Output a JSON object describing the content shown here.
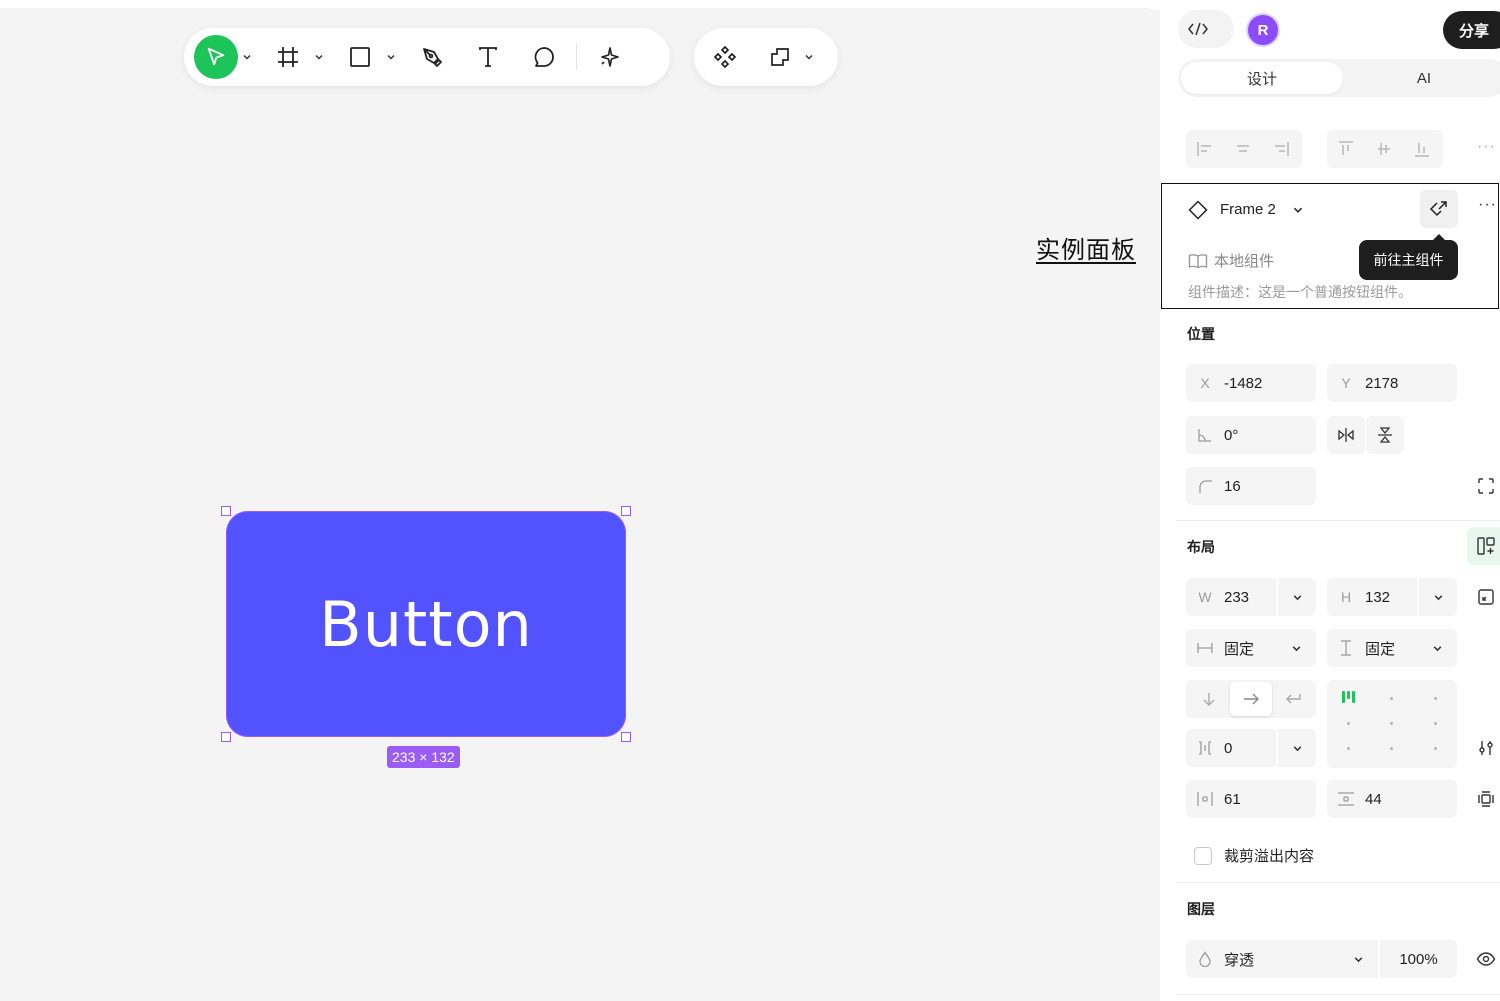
{
  "canvas": {
    "label": "实例面板",
    "frame_text": "Button",
    "size_badge": "233 × 132"
  },
  "toolbar": {
    "tools": [
      "move-tool",
      "frame-tool",
      "rectangle-tool",
      "pen-tool",
      "text-tool",
      "comment-tool",
      "ai-tool"
    ],
    "secondary": [
      "component-tool",
      "boolean-tool"
    ]
  },
  "header": {
    "avatar_initial": "R",
    "share_label": "分享"
  },
  "tabs": [
    {
      "label": "设计",
      "active": true
    },
    {
      "label": "AI",
      "active": false
    }
  ],
  "component": {
    "name": "Frame 2",
    "goto_tooltip": "前往主组件",
    "source": "本地组件",
    "description": "组件描述：这是一个普通按钮组件。"
  },
  "position": {
    "title": "位置",
    "x_label": "X",
    "x": "-1482",
    "y_label": "Y",
    "y": "2178",
    "rotation": "0°",
    "radius": "16"
  },
  "layout": {
    "title": "布局",
    "w_label": "W",
    "w": "233",
    "h_label": "H",
    "h": "132",
    "w_mode": "固定",
    "h_mode": "固定",
    "gap": "0",
    "padding_h": "61",
    "padding_v": "44",
    "clip_label": "裁剪溢出内容",
    "clip_checked": false
  },
  "layer": {
    "title": "图层",
    "blend": "穿透",
    "opacity": "100%"
  },
  "colors": {
    "accent_green": "#1dc45a",
    "frame_fill": "#5352ff",
    "selection": "#9b5cf6",
    "avatar": "#8b4dfb"
  }
}
